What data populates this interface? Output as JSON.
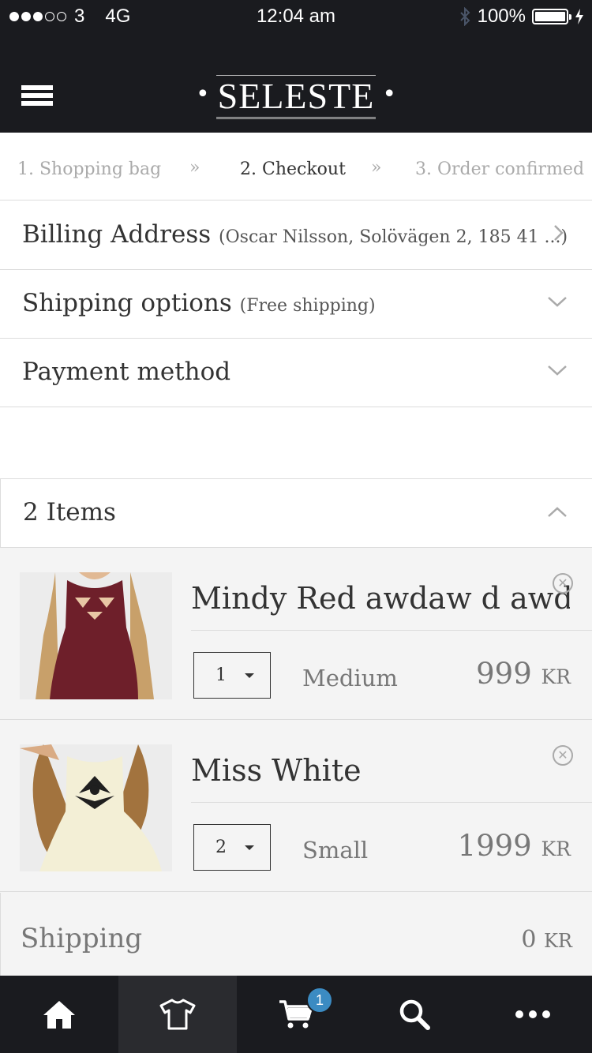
{
  "status_bar": {
    "carrier": "3",
    "network": "4G",
    "time": "12:04 am",
    "battery": "100%"
  },
  "header": {
    "logo": "SELESTE"
  },
  "steps": [
    {
      "label": "1. Shopping bag",
      "state": "done"
    },
    {
      "label": "2. Checkout",
      "state": "active"
    },
    {
      "label": "3. Order confirmed",
      "state": "upcoming"
    }
  ],
  "sections": {
    "billing": {
      "title": "Billing Address",
      "summary": "(Oscar Nilsson, Solövägen 2, 185 41 ...)"
    },
    "shipping": {
      "title": "Shipping options",
      "summary": "(Free shipping)"
    },
    "payment": {
      "title": "Payment method",
      "summary": ""
    }
  },
  "items_header": {
    "title": "2 Items"
  },
  "items": [
    {
      "name": "Mindy Red awdaw d awda...",
      "quantity": "1",
      "size": "Medium",
      "price": "999",
      "currency": "KR",
      "image_color": "#6e1f2a"
    },
    {
      "name": "Miss White",
      "quantity": "2",
      "size": "Small",
      "price": "1999",
      "currency": "KR",
      "image_color": "#f3efd6"
    }
  ],
  "shipping_summary": {
    "label": "Shipping",
    "value": "0",
    "currency": "KR"
  },
  "tabbar": {
    "tabs": [
      {
        "icon": "home-icon"
      },
      {
        "icon": "shirt-icon",
        "active": true
      },
      {
        "icon": "cart-icon",
        "badge": "1"
      },
      {
        "icon": "search-icon"
      },
      {
        "icon": "more-icon"
      }
    ],
    "cart_badge": "1"
  },
  "colors": {
    "header_bg": "#1a1b1f",
    "badge": "#3b8bc2",
    "list_bg": "#f4f4f4"
  }
}
